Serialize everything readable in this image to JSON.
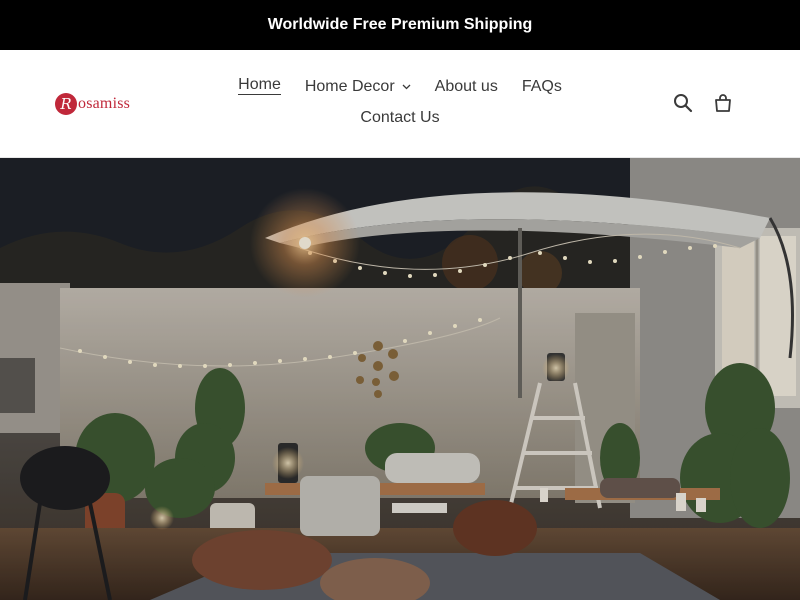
{
  "announcement": {
    "text": "Worldwide Free Premium Shipping"
  },
  "header": {
    "logo": {
      "mark": "R",
      "text": "osamiss",
      "color": "#c0283a"
    },
    "nav": [
      {
        "label": "Home",
        "active": true
      },
      {
        "label": "Home Decor",
        "has_dropdown": true
      },
      {
        "label": "About us"
      },
      {
        "label": "FAQs"
      },
      {
        "label": "Contact Us"
      }
    ],
    "icons": [
      "search-icon",
      "cart-icon"
    ]
  },
  "hero": {
    "image": "Night-time backyard patio with string lights, patio umbrella, lanterns, poufs and potted plants"
  },
  "colors": {
    "announcement_bg": "#000000",
    "announcement_text": "#ffffff",
    "nav_text": "#3a3a3a",
    "brand": "#c0283a"
  }
}
